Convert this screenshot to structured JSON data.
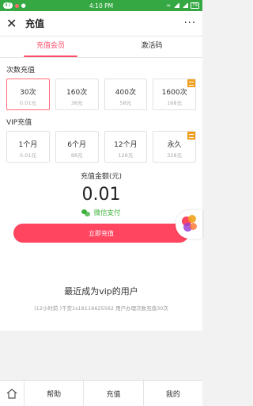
{
  "statusbar": {
    "notifications": "47",
    "time": "4:10 PM",
    "battery": "79"
  },
  "header": {
    "title": "充值",
    "more": "···"
  },
  "tabs": [
    {
      "label": "充值会员"
    },
    {
      "label": "激活码"
    }
  ],
  "times_section": {
    "title": "次数充值",
    "cards": [
      {
        "main": "30次",
        "sub": "0.01元"
      },
      {
        "main": "160次",
        "sub": "38元"
      },
      {
        "main": "400次",
        "sub": "58元"
      },
      {
        "main": "1600次",
        "sub": "168元"
      }
    ]
  },
  "vip_section": {
    "title": "VIP充值",
    "cards": [
      {
        "main": "1个月",
        "sub": "0.01元"
      },
      {
        "main": "6个月",
        "sub": "88元"
      },
      {
        "main": "12个月",
        "sub": "128元"
      },
      {
        "main": "永久",
        "sub": "328元"
      }
    ]
  },
  "payment": {
    "amount_label": "充值金额(元)",
    "amount": "0.01",
    "method": "微信支付",
    "button": "立即充值"
  },
  "recent": {
    "title": "最近成为vip的用户",
    "line": "(12小时前 )千赏1s18116625562 用户办理次数充值30次"
  },
  "bottom_nav": {
    "help": "帮助",
    "recharge": "充值",
    "mine": "我的"
  },
  "colors": {
    "accent": "#ff4560",
    "status_green": "#35a844",
    "wechat_green": "#3bb03b",
    "badge": "#f0a020"
  }
}
